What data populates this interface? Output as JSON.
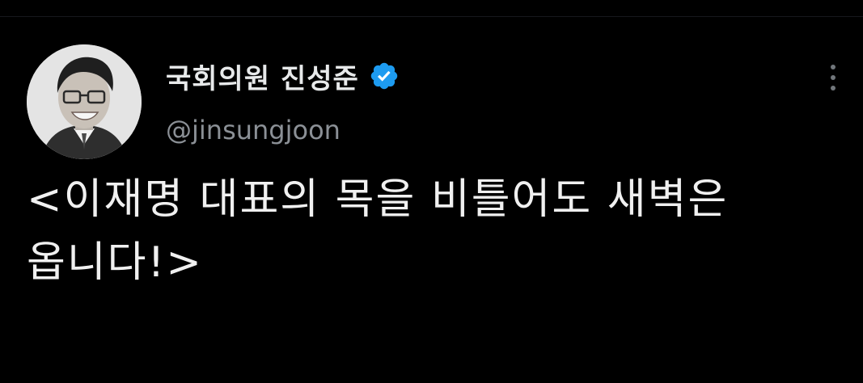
{
  "tweet": {
    "author": {
      "display_name": "국회의원 진성준",
      "handle": "@jinsungjoon",
      "verified": true,
      "avatar_icon": "user-avatar",
      "verified_icon": "verified-badge-icon"
    },
    "text": "<이재명 대표의 목을 비틀어도 새벽은\n옵니다!>",
    "more_icon": "more-options-icon"
  },
  "colors": {
    "background": "#000000",
    "text_primary": "#e7e9ea",
    "text_secondary": "#8b9096",
    "verified_blue": "#1d9bf0"
  }
}
